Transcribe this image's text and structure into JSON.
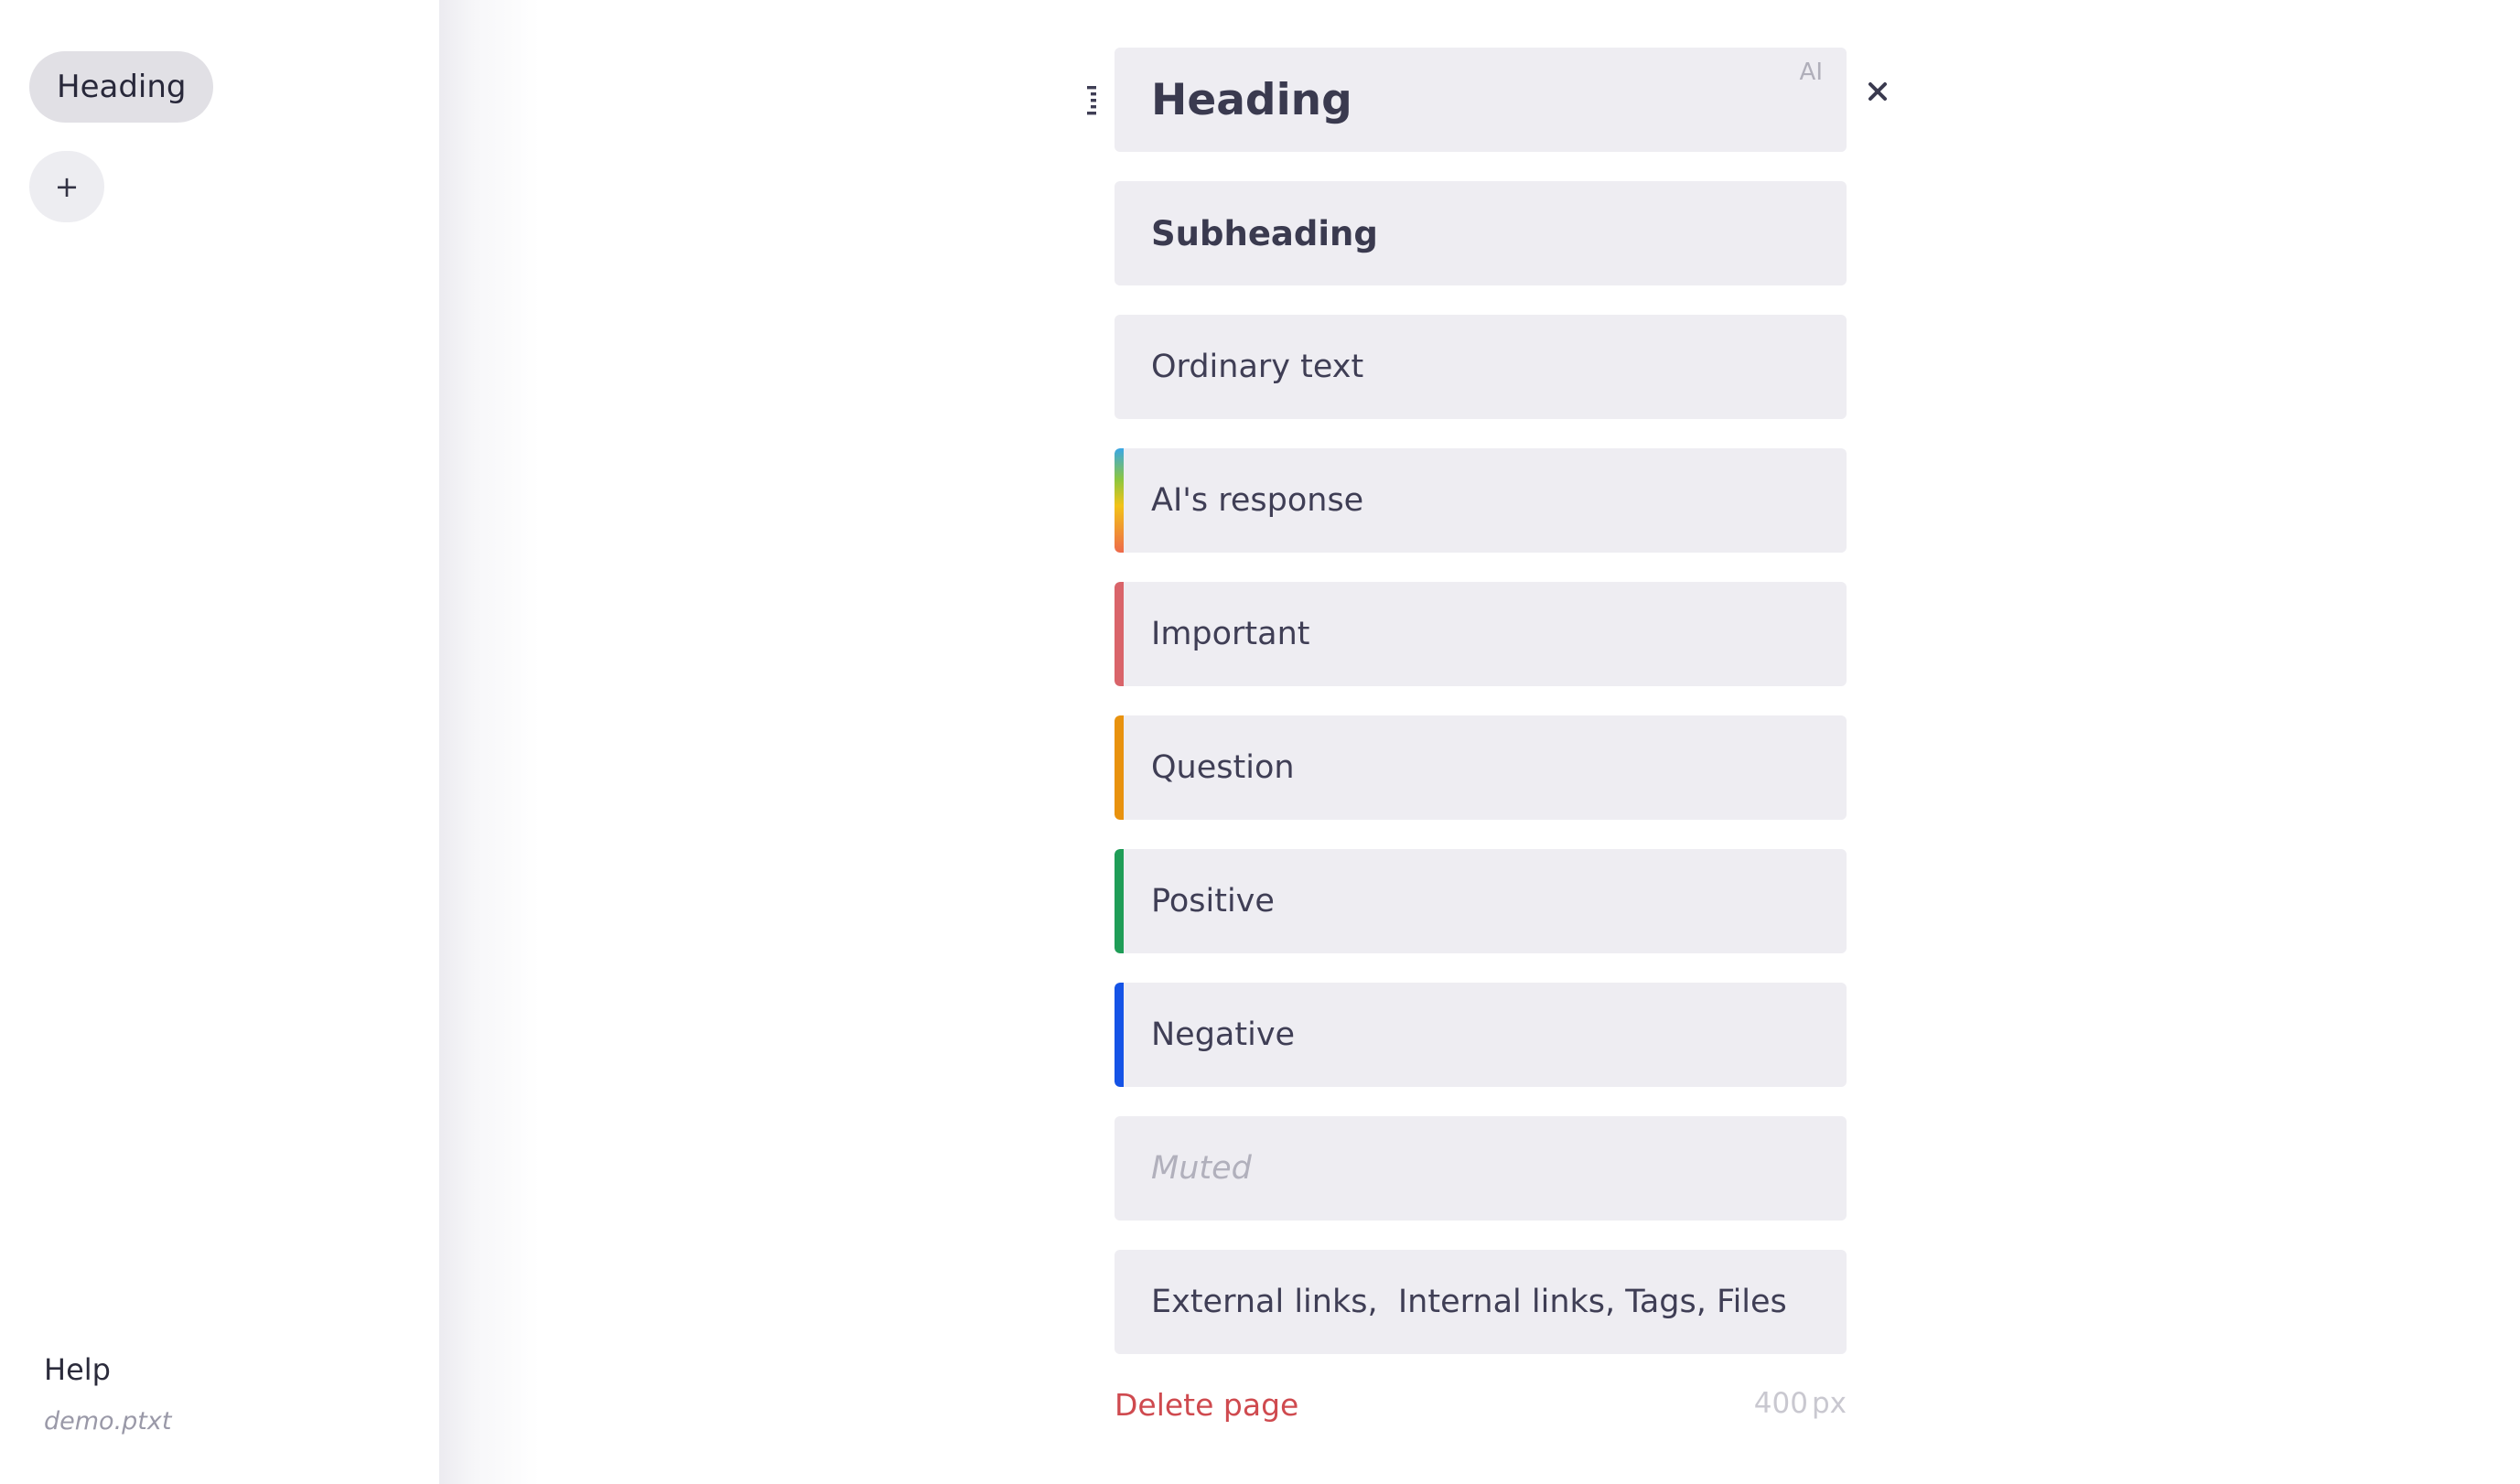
{
  "sidebar": {
    "pages": [
      {
        "label": "Heading"
      }
    ],
    "add_label": "+",
    "help_label": "Help",
    "file_name": "demo.ptxt"
  },
  "editor": {
    "blocks": [
      {
        "type": "heading",
        "text": "Heading",
        "ai_label": "AI"
      },
      {
        "type": "subheading",
        "text": "Subheading"
      },
      {
        "type": "text",
        "text": "Ordinary text"
      },
      {
        "type": "ai-response",
        "text": "AI's response",
        "stripe": "gradient"
      },
      {
        "type": "important",
        "text": "Important",
        "stripe": "#d9646a"
      },
      {
        "type": "question",
        "text": "Question",
        "stripe": "#e8920e"
      },
      {
        "type": "positive",
        "text": "Positive",
        "stripe": "#1f9d57"
      },
      {
        "type": "negative",
        "text": "Negative",
        "stripe": "#1553e6"
      },
      {
        "type": "muted",
        "text": "Muted"
      },
      {
        "type": "links",
        "text": "External links,  Internal links, Tags, Files"
      }
    ],
    "close_icon": "close-icon",
    "drag_icon": "drag-handle-icon",
    "delete_label": "Delete page",
    "width_value": "400",
    "width_unit": "px"
  },
  "colors": {
    "block_bg": "#eeedf2",
    "delete": "#cf4a4f",
    "ai_gradient": [
      "#3aa7e6",
      "#8cc63f",
      "#f2c318",
      "#ee6a4a"
    ]
  }
}
